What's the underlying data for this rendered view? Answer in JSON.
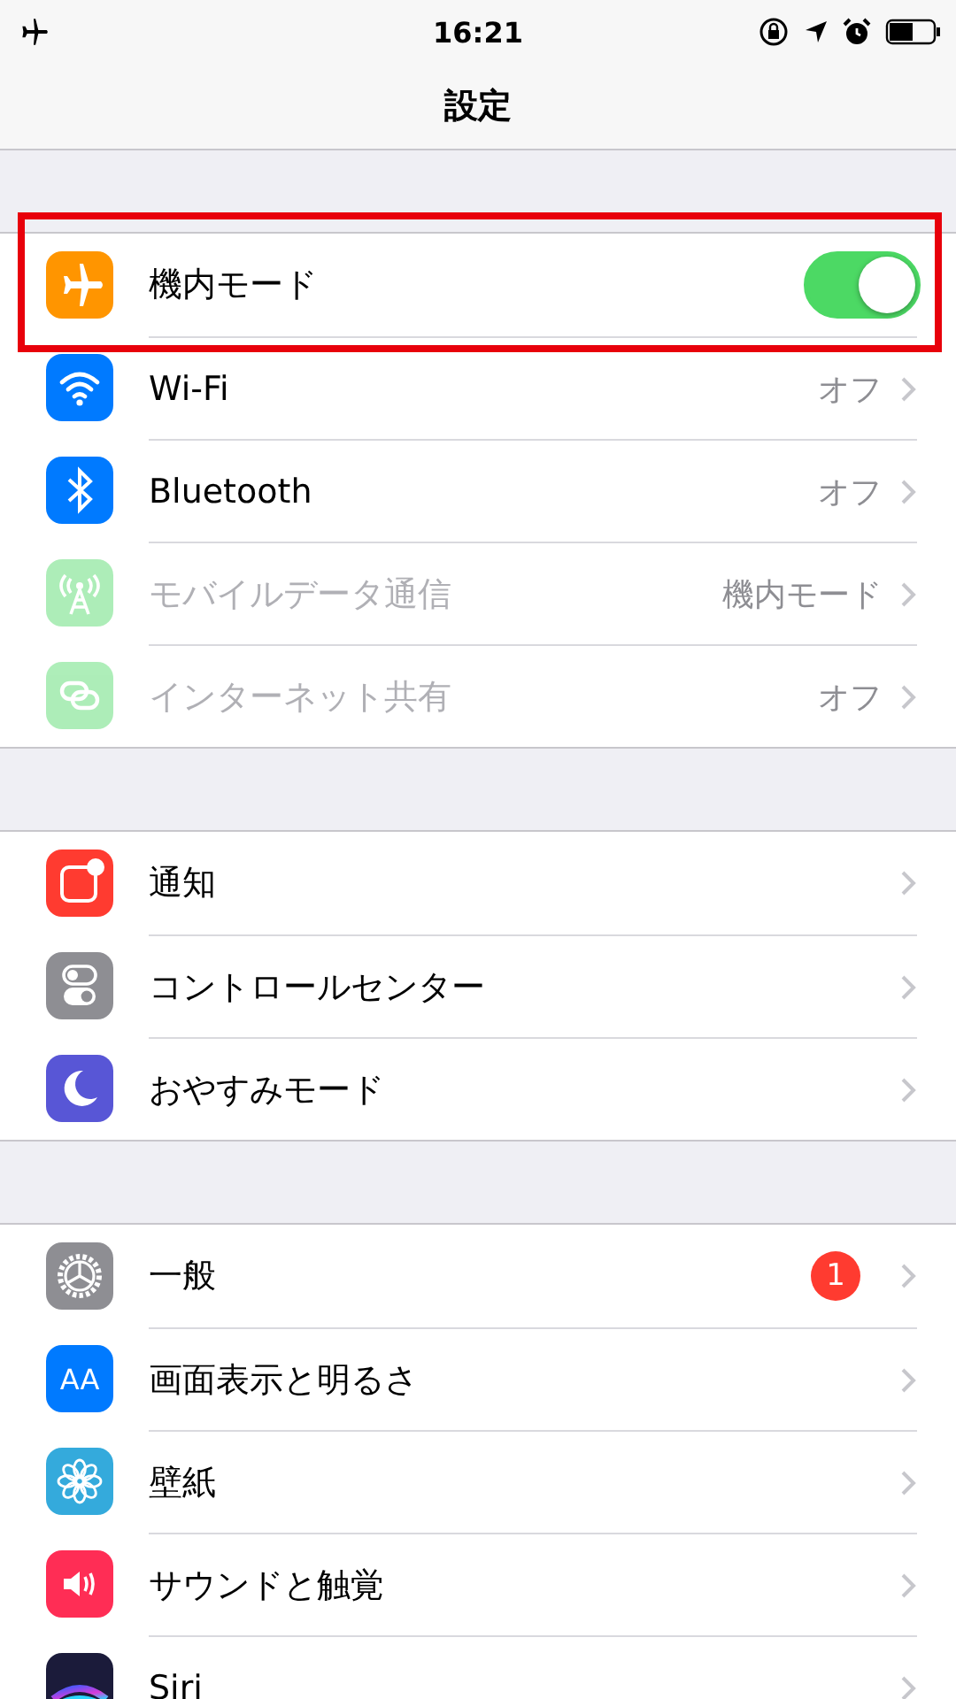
{
  "status_bar": {
    "time": "16:21"
  },
  "nav": {
    "title": "設定"
  },
  "groups": [
    {
      "rows": [
        {
          "label": "機内モード",
          "kind": "toggle",
          "on": true,
          "disabled": false,
          "highlighted": true
        },
        {
          "label": "Wi-Fi",
          "kind": "link",
          "detail": "オフ",
          "disabled": false,
          "highlighted": false
        },
        {
          "label": "Bluetooth",
          "kind": "link",
          "detail": "オフ",
          "disabled": false,
          "highlighted": false
        },
        {
          "label": "モバイルデータ通信",
          "kind": "link",
          "detail": "機内モード",
          "disabled": true,
          "highlighted": false
        },
        {
          "label": "インターネット共有",
          "kind": "link",
          "detail": "オフ",
          "disabled": true,
          "highlighted": false
        }
      ]
    },
    {
      "rows": [
        {
          "label": "通知",
          "kind": "link",
          "disabled": false,
          "highlighted": false
        },
        {
          "label": "コントロールセンター",
          "kind": "link",
          "disabled": false,
          "highlighted": false
        },
        {
          "label": "おやすみモード",
          "kind": "link",
          "disabled": false,
          "highlighted": false
        }
      ]
    },
    {
      "rows": [
        {
          "label": "一般",
          "kind": "link",
          "badge": "1",
          "disabled": false,
          "highlighted": false
        },
        {
          "icon_label": "AA",
          "label": "画面表示と明るさ",
          "kind": "link",
          "disabled": false,
          "highlighted": false
        },
        {
          "label": "壁紙",
          "kind": "link",
          "disabled": false,
          "highlighted": false
        },
        {
          "label": "サウンドと触覚",
          "kind": "link",
          "disabled": false,
          "highlighted": false
        },
        {
          "label": "Siri",
          "kind": "link",
          "disabled": false,
          "highlighted": false
        }
      ]
    }
  ]
}
